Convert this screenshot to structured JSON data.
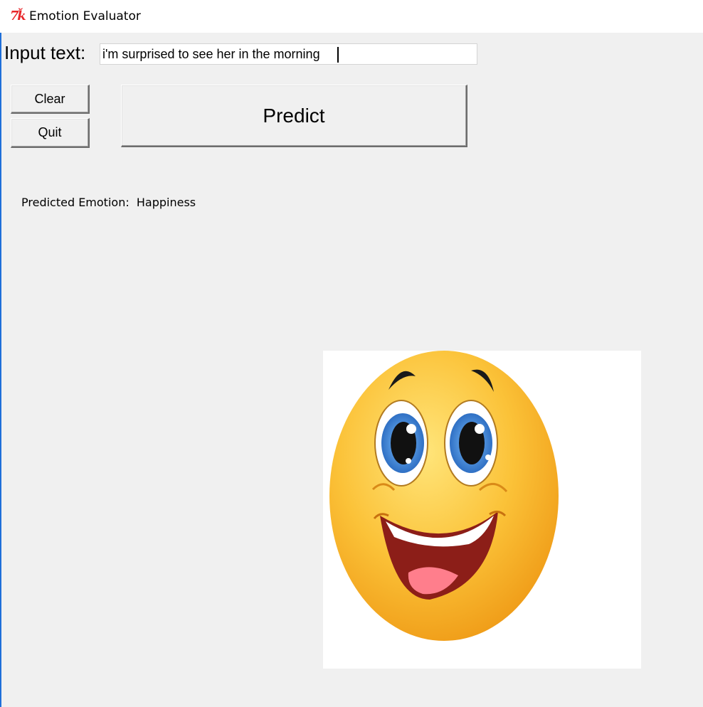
{
  "window": {
    "title": "Emotion Evaluator",
    "icon": "tk-feather-icon"
  },
  "input": {
    "label": "Input text:",
    "value": "i'm surprised to see her in the morning"
  },
  "buttons": {
    "clear": "Clear",
    "quit": "Quit",
    "predict": "Predict"
  },
  "result": {
    "label": "Predicted Emotion:",
    "value": "Happiness"
  },
  "image": {
    "semantic": "happy-smiley-face",
    "face_color": "#f7b21f",
    "eye_color": "#1f5fb8"
  },
  "colors": {
    "window_bg": "#f0f0f0",
    "tk_icon": "#e8262a"
  }
}
